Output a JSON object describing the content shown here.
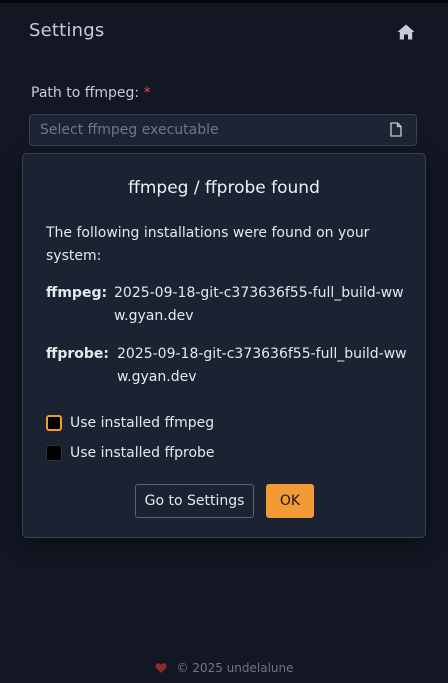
{
  "header": {
    "title": "Settings",
    "home_icon": "home-icon"
  },
  "form": {
    "ffmpeg_path": {
      "label": "Path to ffmpeg:",
      "required_marker": "*",
      "value": "",
      "placeholder": "Select ffmpeg executable",
      "browse_icon": "file-icon"
    }
  },
  "dialog": {
    "title": "ffmpeg / ffprobe found",
    "description": "The following installations were found on your system:",
    "installations": [
      {
        "label": "ffmpeg:",
        "version": "2025-09-18-git-c373636f55-full_build-www.gyan.dev"
      },
      {
        "label": "ffprobe:",
        "version": "2025-09-18-git-c373636f55-full_build-www.gyan.dev"
      }
    ],
    "options": [
      {
        "label": "Use installed ffmpeg",
        "checked": false
      },
      {
        "label": "Use installed ffprobe",
        "checked": false
      }
    ],
    "buttons": {
      "settings": "Go to Settings",
      "ok": "OK"
    }
  },
  "footer": {
    "text": "© 2025 undelalune",
    "icon": "heart-icon"
  },
  "colors": {
    "background": "#121723",
    "dialog_background": "#1b2231",
    "accent": "#f29a33",
    "required": "#e5484d",
    "heart": "#8f2d2d"
  }
}
